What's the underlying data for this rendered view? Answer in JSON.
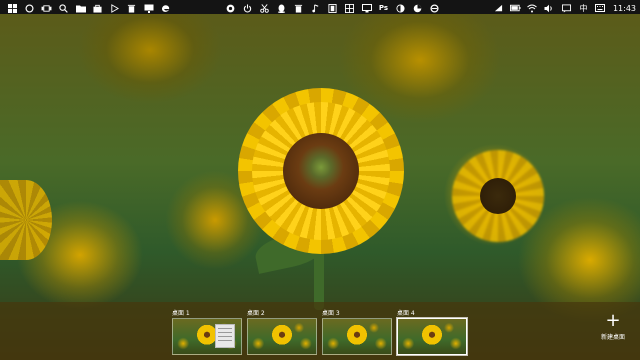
{
  "taskbar": {
    "left_icons": [
      "start-icon",
      "cortana-icon",
      "task-view-icon",
      "search-icon",
      "folder-icon",
      "store-icon",
      "media-icon",
      "trash-icon",
      "monitor-icon",
      "edge-icon"
    ],
    "middle_icons": [
      "chrome-icon",
      "power-icon",
      "scissors-icon",
      "qq-icon",
      "trash-icon",
      "music-icon",
      "film-icon",
      "grid-icon",
      "monitor-icon",
      "ps-icon",
      "contrast-icon",
      "pie-icon",
      "ie-icon"
    ],
    "middle_labels": {
      "ps": "Ps"
    },
    "tray": {
      "ime": "中",
      "clock": "11:43"
    }
  },
  "desktops": [
    {
      "label": "桌面 1",
      "active": false
    },
    {
      "label": "桌面 2",
      "active": false
    },
    {
      "label": "桌面 3",
      "active": false
    },
    {
      "label": "桌面 4",
      "active": true
    }
  ],
  "new_desktop": {
    "label": "新建桌面"
  }
}
